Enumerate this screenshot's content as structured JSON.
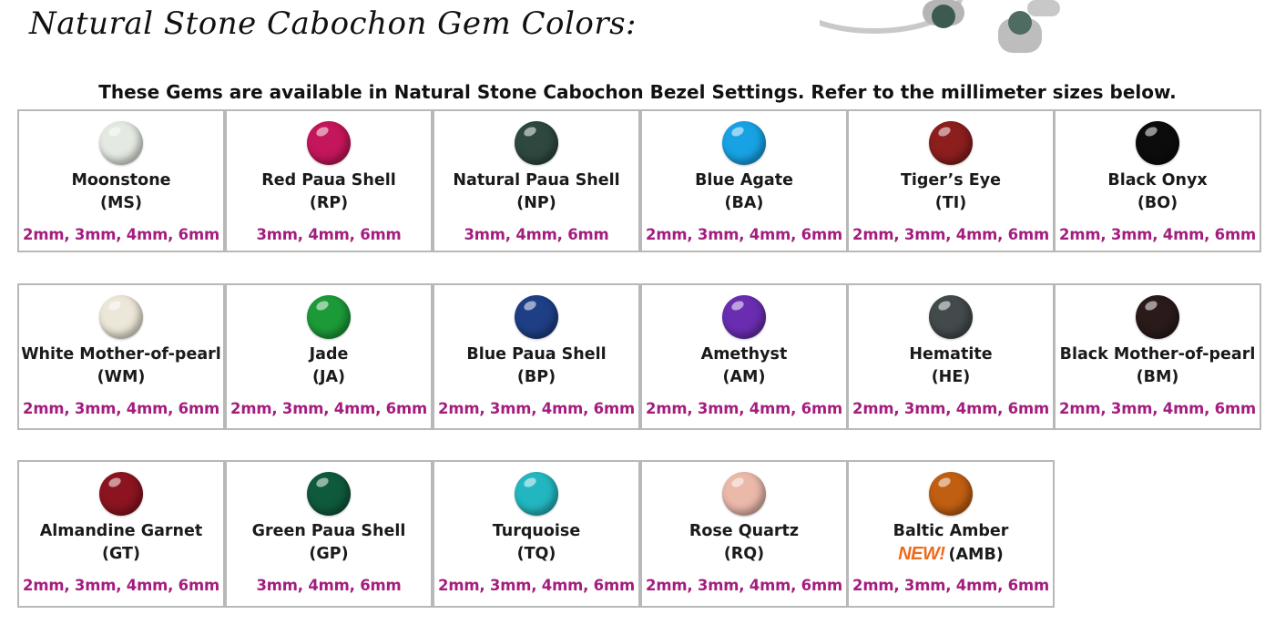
{
  "header": {
    "title": "Natural Stone Cabochon Gem Colors:",
    "subtitle": "These Gems are available in Natural Stone Cabochon Bezel Settings.  Refer to the millimeter sizes below."
  },
  "new_badge": "NEW!",
  "gems": [
    {
      "name": "Moonstone",
      "code": "(MS)",
      "sizes": "2mm, 3mm, 4mm, 6mm",
      "color": "#e4e9e2"
    },
    {
      "name": "Red Paua Shell",
      "code": "(RP)",
      "sizes": "3mm, 4mm, 6mm",
      "color": "#c4165a"
    },
    {
      "name": "Natural Paua Shell",
      "code": "(NP)",
      "sizes": "3mm, 4mm, 6mm",
      "color": "#2e4840"
    },
    {
      "name": "Blue Agate",
      "code": "(BA)",
      "sizes": "2mm, 3mm, 4mm, 6mm",
      "color": "#18a2e4"
    },
    {
      "name": "Tiger’s Eye",
      "code": "(TI)",
      "sizes": "2mm, 3mm, 4mm, 6mm",
      "color": "#8c1e1e"
    },
    {
      "name": "Black Onyx",
      "code": "(BO)",
      "sizes": "2mm, 3mm, 4mm, 6mm",
      "color": "#0c0c0c"
    },
    {
      "name": "White Mother-of-pearl",
      "code": "(WM)",
      "sizes": "2mm, 3mm, 4mm, 6mm",
      "color": "#ece7d8"
    },
    {
      "name": "Jade",
      "code": "(JA)",
      "sizes": "2mm, 3mm, 4mm, 6mm",
      "color": "#1c9a38"
    },
    {
      "name": "Blue Paua Shell",
      "code": "(BP)",
      "sizes": "2mm, 3mm, 4mm, 6mm",
      "color": "#1e3f86"
    },
    {
      "name": "Amethyst",
      "code": "(AM)",
      "sizes": "2mm, 3mm, 4mm, 6mm",
      "color": "#6a2db2"
    },
    {
      "name": "Hematite",
      "code": "(HE)",
      "sizes": "2mm, 3mm, 4mm, 6mm",
      "color": "#434a4c"
    },
    {
      "name": "Black Mother-of-pearl",
      "code": "(BM)",
      "sizes": "2mm, 3mm, 4mm, 6mm",
      "color": "#2a1a1a"
    },
    {
      "name": "Almandine Garnet",
      "code": "(GT)",
      "sizes": "2mm, 3mm, 4mm, 6mm",
      "color": "#8c1420"
    },
    {
      "name": "Green Paua Shell",
      "code": "(GP)",
      "sizes": "3mm, 4mm, 6mm",
      "color": "#0f5a3c"
    },
    {
      "name": "Turquoise",
      "code": "(TQ)",
      "sizes": "2mm, 3mm, 4mm, 6mm",
      "color": "#22b7c0"
    },
    {
      "name": "Rose Quartz",
      "code": "(RQ)",
      "sizes": "2mm, 3mm, 4mm, 6mm",
      "color": "#eab9aa"
    },
    {
      "name": "Baltic Amber",
      "code": "(AMB)",
      "sizes": "2mm, 3mm, 4mm, 6mm",
      "color": "#c05e12"
    }
  ]
}
